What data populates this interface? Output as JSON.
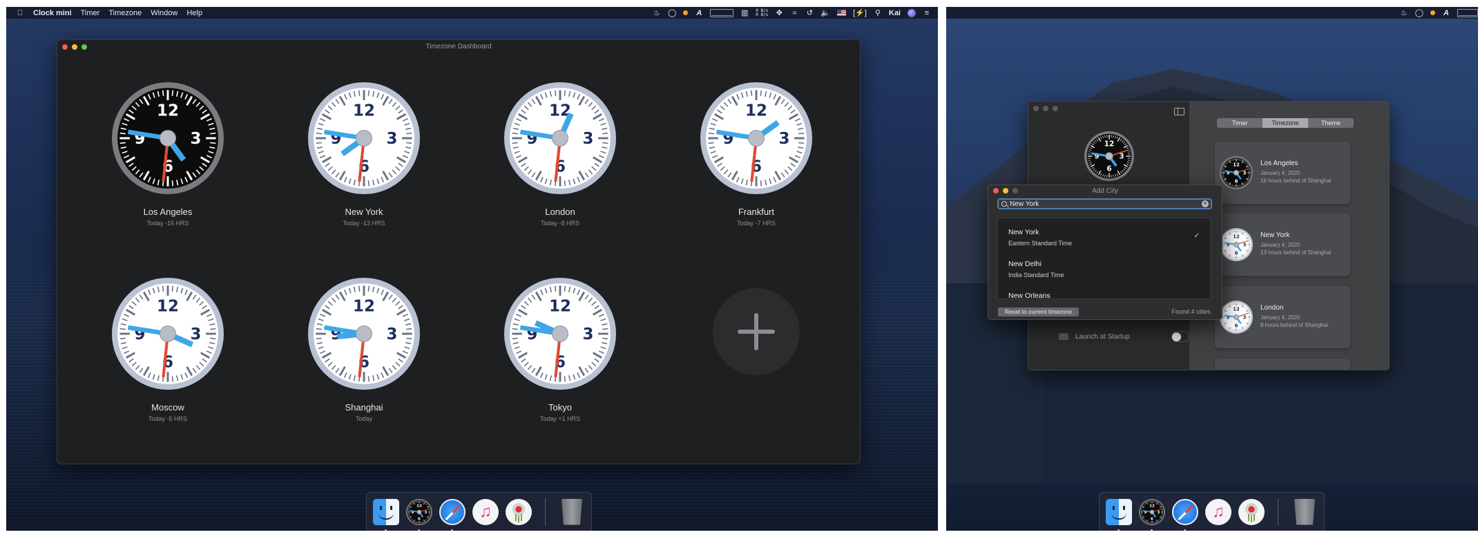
{
  "left": {
    "menubar": {
      "app_name": "Clock mini",
      "menus": [
        "Timer",
        "Timezone",
        "Window",
        "Help"
      ],
      "net_up": "0 B/s",
      "net_down": "0 B/s",
      "user": "Kai"
    },
    "window": {
      "title": "Timezone Dashboard",
      "clocks": [
        {
          "city": "Los Angeles",
          "offset": "Today -16 HRS",
          "theme": "dark",
          "hour": 4.8,
          "minute": 46.5,
          "second": 31
        },
        {
          "city": "New York",
          "offset": "Today -13 HRS",
          "theme": "light",
          "hour": 7.8,
          "minute": 46.5,
          "second": 31
        },
        {
          "city": "London",
          "offset": "Today -8 HRS",
          "theme": "light",
          "hour": 0.8,
          "minute": 46.5,
          "second": 31
        },
        {
          "city": "Frankfurt",
          "offset": "Today -7 HRS",
          "theme": "light",
          "hour": 1.8,
          "minute": 46.5,
          "second": 31
        },
        {
          "city": "Moscow",
          "offset": "Today -5 HRS",
          "theme": "light",
          "hour": 3.8,
          "minute": 46.5,
          "second": 31
        },
        {
          "city": "Shanghai",
          "offset": "Today",
          "theme": "light",
          "hour": 8.8,
          "minute": 46.5,
          "second": 31
        },
        {
          "city": "Tokyo",
          "offset": "Today +1 HRS",
          "theme": "light",
          "hour": 9.8,
          "minute": 46.5,
          "second": 31
        }
      ],
      "add_button_icon": "plus-icon"
    },
    "dock": [
      "Finder",
      "Clock mini",
      "Safari",
      "Music",
      "Photos",
      "Trash"
    ]
  },
  "right": {
    "prefs": {
      "tabs": [
        "Timer",
        "Timezone",
        "Theme"
      ],
      "active_tab": "Timezone",
      "cards": [
        {
          "city": "Los Angeles",
          "date": "January 4, 2020",
          "diff": "16 hours behind of Shanghai",
          "theme": "dark"
        },
        {
          "city": "New York",
          "date": "January 4, 2020",
          "diff": "13 hours behind of Shanghai",
          "theme": "light"
        },
        {
          "city": "London",
          "date": "January 4, 2020",
          "diff": "8 hours behind of Shanghai",
          "theme": "light"
        }
      ],
      "launch_label": "Launch at Startup",
      "launch_enabled": false
    },
    "add_city": {
      "title": "Add City",
      "search_value": "New York",
      "results": [
        {
          "name": "New York",
          "zone": "Eastern Standard Time",
          "selected": true
        },
        {
          "name": "New Delhi",
          "zone": "India Standard Time",
          "selected": false
        },
        {
          "name": "New Orleans",
          "zone": "",
          "selected": false
        }
      ],
      "check_glyph": "✓",
      "reset_label": "Reset to current timezone",
      "found_text": "Found 4 cities."
    },
    "dock": [
      "Finder",
      "Clock mini",
      "Safari",
      "Music",
      "Photos",
      "Trash"
    ]
  },
  "colors": {
    "hand_blue": "#3ea6e8",
    "second_red": "#e04a2f",
    "numeral_navy": "#1c2e5c",
    "search_focus": "#4c7fb4"
  }
}
